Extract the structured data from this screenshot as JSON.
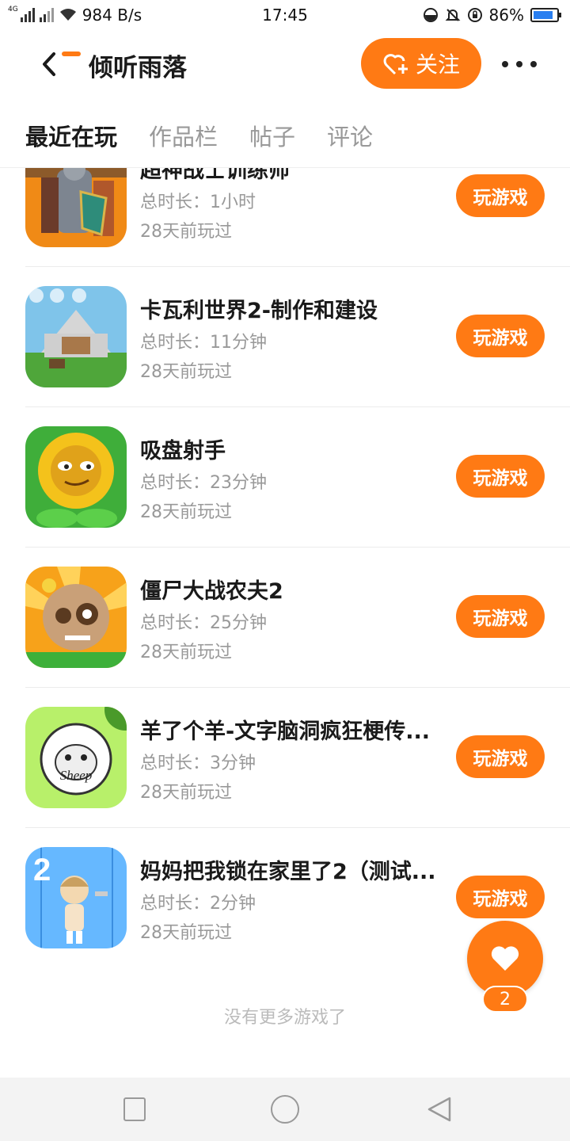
{
  "status_bar": {
    "network": "4G",
    "speed": "984 B/s",
    "time": "17:45",
    "battery": "86%",
    "battery_level": 0.86
  },
  "header": {
    "title": "倾听雨落",
    "follow_label": "关注"
  },
  "tabs": [
    {
      "label": "最近在玩",
      "active": true
    },
    {
      "label": "作品栏",
      "active": false
    },
    {
      "label": "帖子",
      "active": false
    },
    {
      "label": "评论",
      "active": false
    }
  ],
  "games": [
    {
      "name": "超神战士训练师",
      "duration": "总时长：1小时",
      "last_played": "28天前玩过",
      "button": "玩游戏"
    },
    {
      "name": "卡瓦利世界2-制作和建设",
      "duration": "总时长：11分钟",
      "last_played": "28天前玩过",
      "button": "玩游戏"
    },
    {
      "name": "吸盘射手",
      "duration": "总时长：23分钟",
      "last_played": "28天前玩过",
      "button": "玩游戏"
    },
    {
      "name": "僵尸大战农夫2",
      "duration": "总时长：25分钟",
      "last_played": "28天前玩过",
      "button": "玩游戏"
    },
    {
      "name": "羊了个羊-文字脑洞疯狂梗传...",
      "duration": "总时长：3分钟",
      "last_played": "28天前玩过",
      "button": "玩游戏"
    },
    {
      "name": "妈妈把我锁在家里了2（测试...",
      "duration": "总时长：2分钟",
      "last_played": "28天前玩过",
      "button": "玩游戏"
    }
  ],
  "icon_texts": {
    "sheep": "Sheep",
    "mom_number": "2"
  },
  "footer_text": "没有更多游戏了",
  "like_count": "2",
  "colors": {
    "accent": "#ff7a14"
  }
}
